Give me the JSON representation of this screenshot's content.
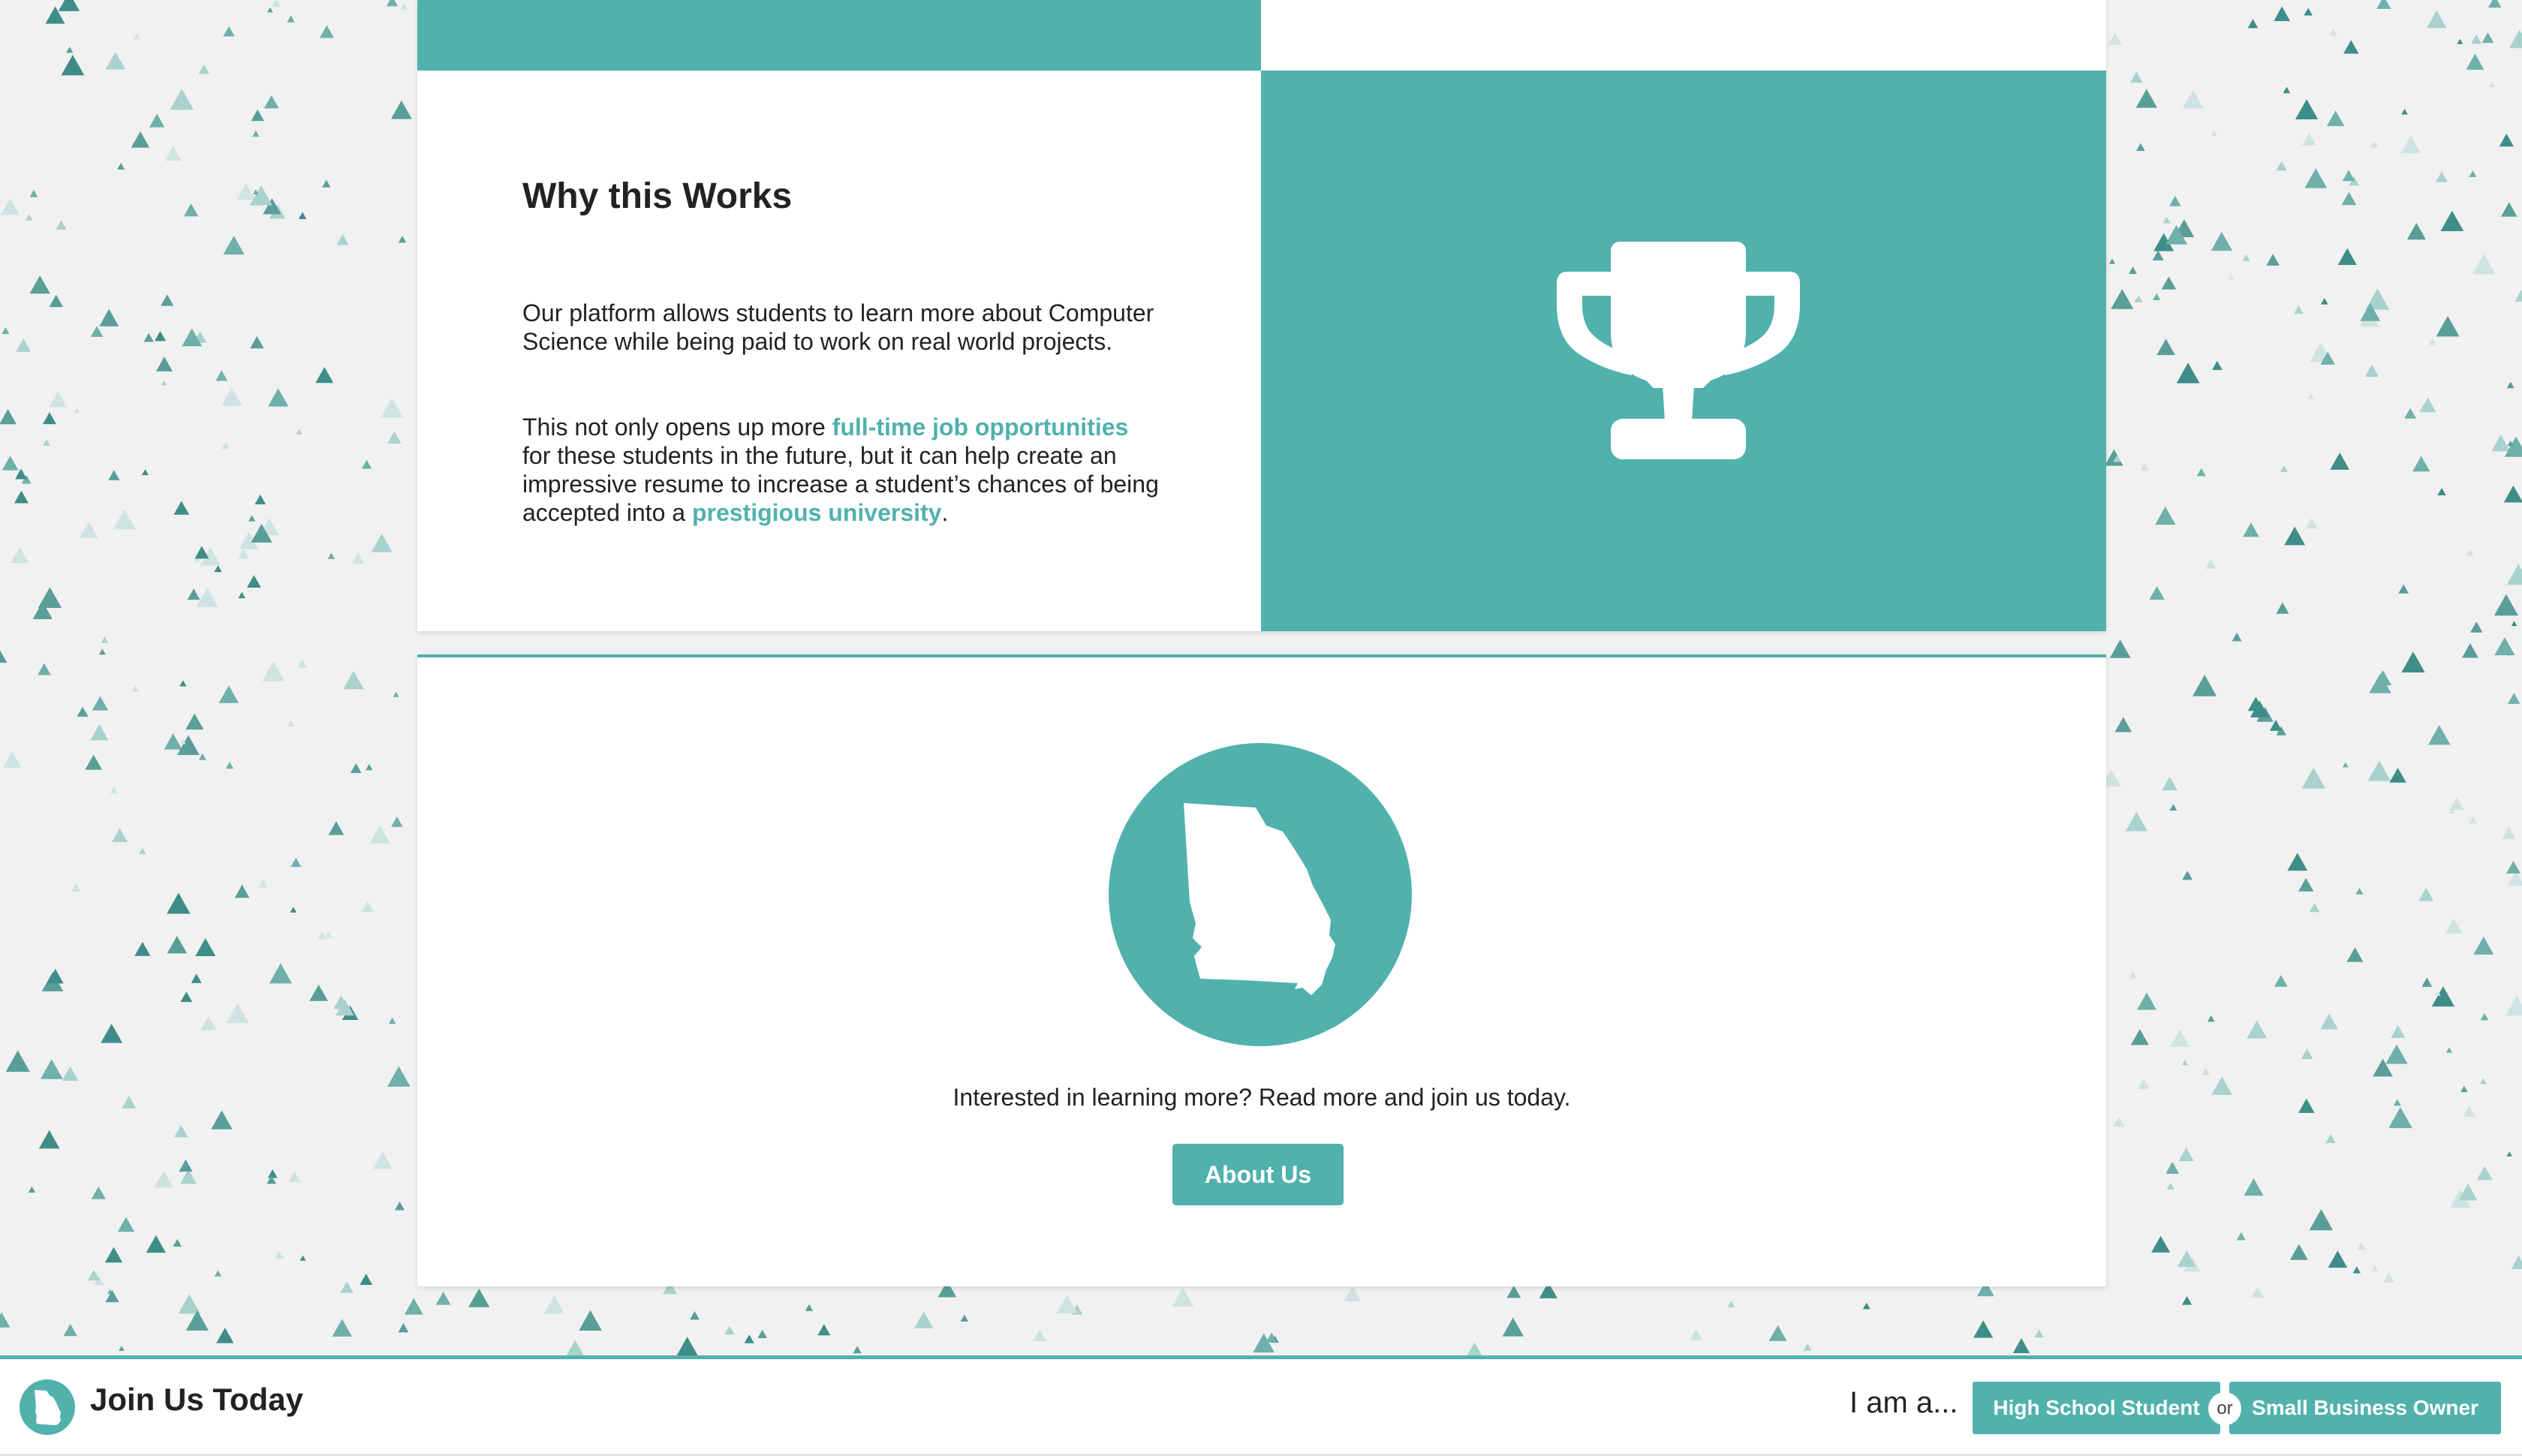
{
  "colors": {
    "accent": "#51b1ad",
    "background": "#f1f1f1",
    "text": "#222222"
  },
  "why_section": {
    "title": "Why this Works",
    "para1": "Our platform allows students to learn more about Computer Science while being paid to work on real world projects.",
    "para2_part1": "This not only opens up more ",
    "para2_link1": "full-time job opportunities",
    "para2_part2": " for these students in the future, but it can help create an impressive resume to increase a student’s chances of being accepted into a ",
    "para2_link2": "prestigious university",
    "para2_part3": ".",
    "icon": "trophy-icon"
  },
  "learn_section": {
    "icon": "georgia-state-icon",
    "text": "Interested in learning more? Read more and join us today.",
    "button_label": "About Us"
  },
  "footer": {
    "logo_icon": "georgia-state-icon",
    "title": "Join Us Today",
    "iam_label": "I am a...",
    "btn_high_school": "High School Student",
    "or_label": "or",
    "btn_small_business": "Small Business Owner"
  }
}
